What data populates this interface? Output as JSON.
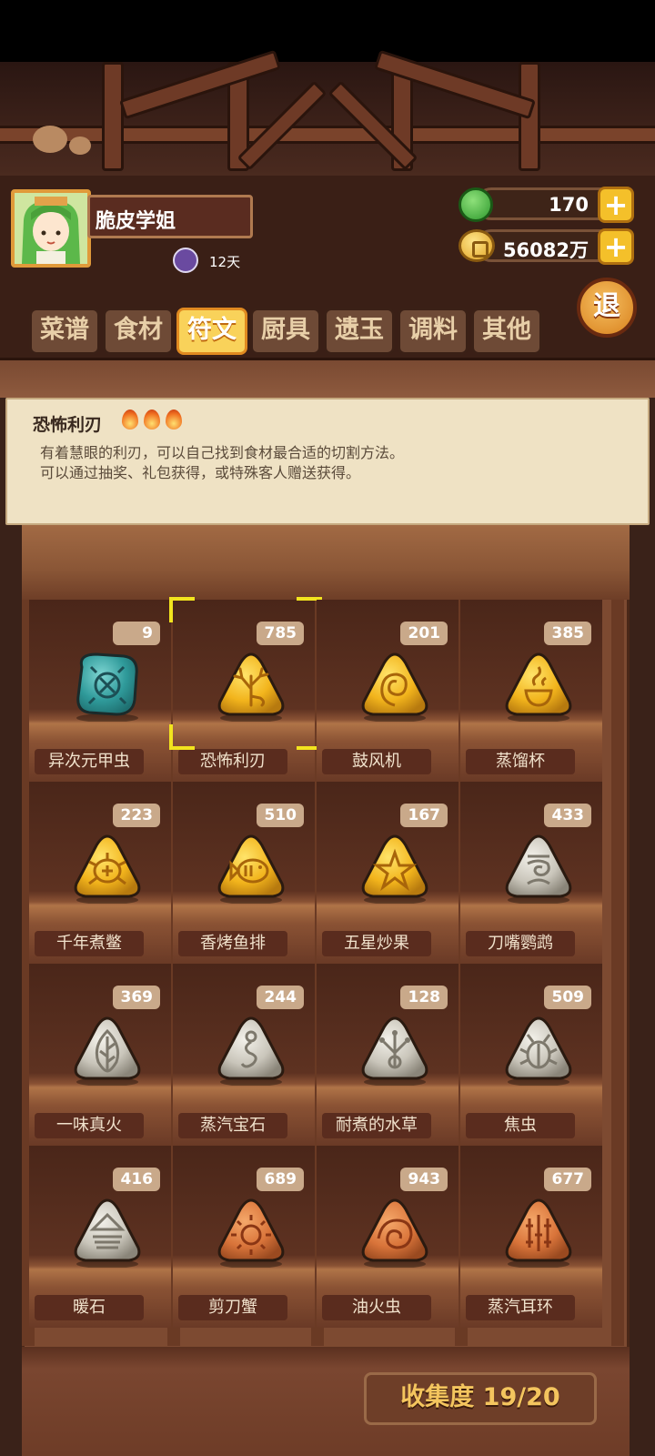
{
  "player": {
    "name": "脆皮学姐",
    "days": "12天"
  },
  "currency": {
    "jade": "170",
    "coins": "56082万",
    "plus_label": "+"
  },
  "exit_label": "退",
  "tabs": [
    {
      "label": "菜谱",
      "active": false
    },
    {
      "label": "食材",
      "active": false
    },
    {
      "label": "符文",
      "active": true
    },
    {
      "label": "厨具",
      "active": false
    },
    {
      "label": "遗玉",
      "active": false
    },
    {
      "label": "调料",
      "active": false
    },
    {
      "label": "其他",
      "active": false
    }
  ],
  "detail": {
    "title": "恐怖利刃",
    "flames": 3,
    "line1": "有着慧眼的利刃，可以自己找到食材最合适的切割方法。",
    "line2": "可以通过抽奖、礼包获得，或特殊客人赠送获得。"
  },
  "runes": [
    {
      "name": "异次元甲虫",
      "count": "9",
      "color": "teal",
      "icon": "beetle-rune-icon"
    },
    {
      "name": "恐怖利刃",
      "count": "785",
      "color": "gold",
      "icon": "antler-rune-icon",
      "selected": true
    },
    {
      "name": "鼓风机",
      "count": "201",
      "color": "gold",
      "icon": "spiral-shell-rune-icon"
    },
    {
      "name": "蒸馏杯",
      "count": "385",
      "color": "gold",
      "icon": "steaming-cup-rune-icon"
    },
    {
      "name": "千年煮鳖",
      "count": "223",
      "color": "gold",
      "icon": "turtle-rune-icon"
    },
    {
      "name": "香烤鱼排",
      "count": "510",
      "color": "gold",
      "icon": "fish-rune-icon"
    },
    {
      "name": "五星炒果",
      "count": "167",
      "color": "gold",
      "icon": "star-rune-icon"
    },
    {
      "name": "刀嘴鹦鹉",
      "count": "433",
      "color": "silver",
      "icon": "parrot-rune-icon"
    },
    {
      "name": "一味真火",
      "count": "369",
      "color": "silver",
      "icon": "leaf-flame-rune-icon"
    },
    {
      "name": "蒸汽宝石",
      "count": "244",
      "color": "silver",
      "icon": "steam-swirl-rune-icon"
    },
    {
      "name": "耐煮的水草",
      "count": "128",
      "color": "silver",
      "icon": "waterweed-rune-icon"
    },
    {
      "name": "焦虫",
      "count": "509",
      "color": "silver",
      "icon": "bug-rune-icon"
    },
    {
      "name": "暖石",
      "count": "416",
      "color": "silver",
      "icon": "warm-stone-rune-icon"
    },
    {
      "name": "剪刀蟹",
      "count": "689",
      "color": "copper",
      "icon": "sun-crab-rune-icon"
    },
    {
      "name": "油火虫",
      "count": "943",
      "color": "copper",
      "icon": "shell-bug-rune-icon"
    },
    {
      "name": "蒸汽耳环",
      "count": "677",
      "color": "copper",
      "icon": "earring-rune-icon"
    }
  ],
  "rune_colors": {
    "teal": [
      "#7fd6d3",
      "#2f9a9a",
      "#1f6f70"
    ],
    "gold": [
      "#ffe46a",
      "#f2b41c",
      "#b77a0f"
    ],
    "silver": [
      "#f3f1ea",
      "#c9c5ba",
      "#8a8579"
    ],
    "copper": [
      "#f5a86a",
      "#d9743a",
      "#9a4a20"
    ]
  },
  "collection": "收集度 19/20"
}
